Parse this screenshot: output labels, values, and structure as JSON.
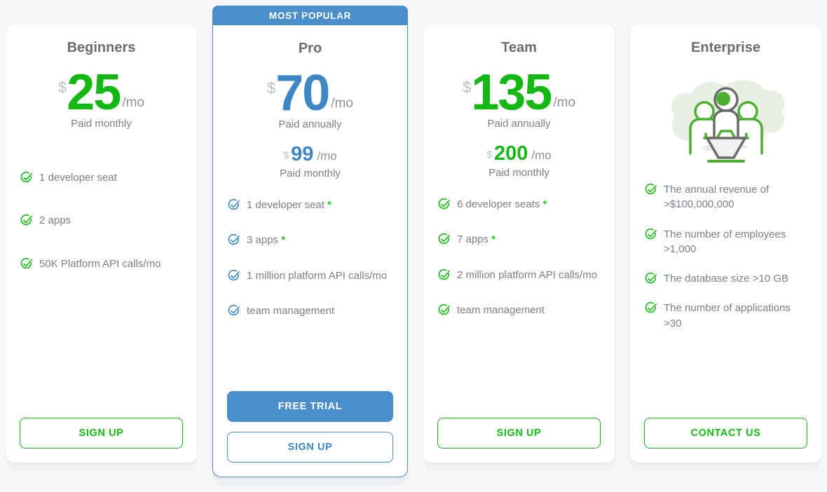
{
  "plans": [
    {
      "id": "beginners",
      "name": "Beginners",
      "badge": null,
      "price": {
        "currency": "$",
        "amount": "25",
        "period": "/mo",
        "note": "Paid monthly",
        "color": "#15b715"
      },
      "secondary_price": null,
      "features": [
        {
          "text": "1 developer seat",
          "star": ""
        },
        {
          "text": "2 apps",
          "star": ""
        },
        {
          "text": "50K Platform API calls/mo",
          "star": ""
        }
      ],
      "primary_button": null,
      "secondary_button": {
        "label": "SIGN UP",
        "style": "outline-green"
      }
    },
    {
      "id": "pro",
      "name": "Pro",
      "badge": "MOST POPULAR",
      "price": {
        "currency": "$",
        "amount": "70",
        "period": "/mo",
        "note": "Paid annually",
        "color": "#3f86c4"
      },
      "secondary_price": {
        "currency": "$",
        "amount": "99",
        "period": "/mo",
        "note": "Paid monthly",
        "color": "#3f86c4"
      },
      "features": [
        {
          "text": "1 developer seat",
          "star": "*"
        },
        {
          "text": "3 apps",
          "star": "*"
        },
        {
          "text": "1 million platform API calls/mo",
          "star": ""
        },
        {
          "text": "team management",
          "star": ""
        }
      ],
      "primary_button": {
        "label": "FREE TRIAL",
        "style": "solid-blue"
      },
      "secondary_button": {
        "label": "SIGN UP",
        "style": "outline-blue"
      }
    },
    {
      "id": "team",
      "name": "Team",
      "badge": null,
      "price": {
        "currency": "$",
        "amount": "135",
        "period": "/mo",
        "note": "Paid annually",
        "color": "#15b715"
      },
      "secondary_price": {
        "currency": "$",
        "amount": "200",
        "period": "/mo",
        "note": "Paid monthly",
        "color": "#15b715"
      },
      "features": [
        {
          "text": "6 developer seats",
          "star": "*"
        },
        {
          "text": "7 apps",
          "star": "*"
        },
        {
          "text": "2 million platform API calls/mo",
          "star": ""
        },
        {
          "text": "team management",
          "star": ""
        }
      ],
      "primary_button": null,
      "secondary_button": {
        "label": "SIGN UP",
        "style": "outline-green"
      }
    },
    {
      "id": "enterprise",
      "name": "Enterprise",
      "badge": null,
      "price": null,
      "secondary_price": null,
      "illustration": "team-meeting-illustration",
      "features": [
        {
          "text": "The annual revenue of >$100,000,000",
          "star": ""
        },
        {
          "text": "The number of employees >1,000",
          "star": ""
        },
        {
          "text": "The database size >10 GB",
          "star": ""
        },
        {
          "text": "The number of applications >30",
          "star": ""
        }
      ],
      "primary_button": null,
      "secondary_button": {
        "label": "CONTACT US",
        "style": "outline-green"
      }
    }
  ],
  "colors": {
    "green": "#15b715",
    "blue": "#4a8fc9",
    "text_gray": "#7b8186",
    "title_gray": "#6d6d6d",
    "page_bg": "#f7f7f7"
  }
}
